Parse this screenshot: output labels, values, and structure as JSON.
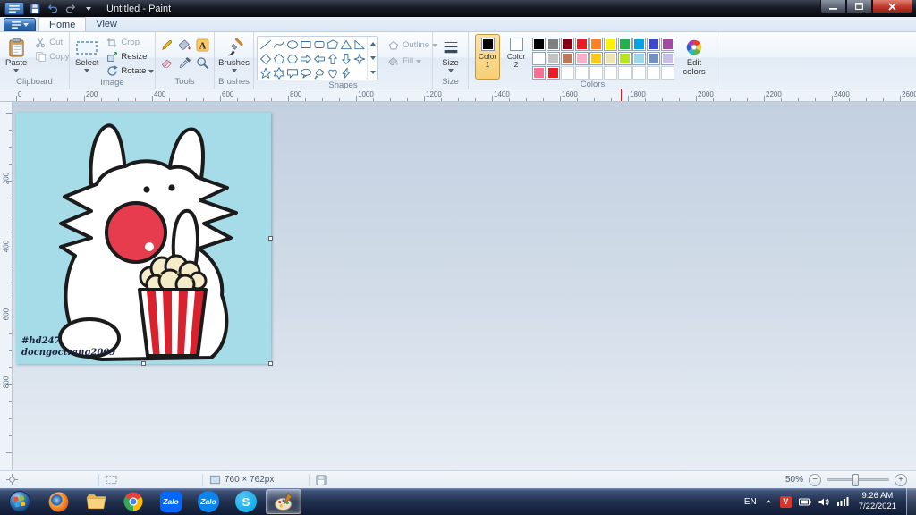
{
  "window": {
    "title": "Untitled - Paint"
  },
  "menu": {
    "home_tab": "Home",
    "view_tab": "View"
  },
  "ribbon": {
    "clipboard": {
      "label": "Clipboard",
      "paste": "Paste",
      "cut": "Cut",
      "copy": "Copy"
    },
    "image": {
      "label": "Image",
      "select": "Select",
      "crop": "Crop",
      "resize": "Resize",
      "rotate": "Rotate"
    },
    "tools": {
      "label": "Tools",
      "items": [
        "pencil",
        "fill",
        "text",
        "eraser",
        "picker",
        "magnifier"
      ]
    },
    "brushes": {
      "label": "Brushes"
    },
    "shapes": {
      "label": "Shapes",
      "outline": "Outline",
      "fill": "Fill",
      "items": [
        "line",
        "curve",
        "oval",
        "rectangle",
        "rounded-rectangle",
        "polygon",
        "triangle",
        "right-triangle",
        "diamond",
        "pentagon",
        "hexagon",
        "arrow-right",
        "arrow-left",
        "arrow-up",
        "arrow-down",
        "star-4",
        "star-5",
        "star-6",
        "callout-rect",
        "callout-oval",
        "callout-cloud",
        "heart",
        "lightning"
      ]
    },
    "size": {
      "label": "Size"
    },
    "colors": {
      "label": "Colors",
      "color1_label": "Color 1",
      "color2_label": "Color 2",
      "color1_value": "#000000",
      "color2_value": "#ffffff",
      "edit_label": "Edit colors",
      "palette": [
        [
          "#000000",
          "#7f7f7f",
          "#880015",
          "#ed1c24",
          "#ff7f27",
          "#fff200",
          "#22b14c",
          "#00a2e8",
          "#3f48cc",
          "#a349a4"
        ],
        [
          "#ffffff",
          "#c3c3c3",
          "#b97a57",
          "#ffaec9",
          "#ffc90e",
          "#efe4b0",
          "#b5e61d",
          "#99d9ea",
          "#7092be",
          "#c8bfe7"
        ],
        [
          "#ff6e8e",
          "#ed1c24",
          null,
          null,
          null,
          null,
          null,
          null,
          null,
          null
        ]
      ]
    }
  },
  "ruler": {
    "h_labels": [
      0,
      200,
      400,
      600,
      800,
      1000,
      1200,
      1400,
      1600,
      1800,
      2000,
      2200,
      2400,
      2600
    ],
    "v_labels": [
      200,
      400,
      600,
      800
    ],
    "marker_units": 1780
  },
  "canvas": {
    "bg_color": "#a6dbe8",
    "signature_line1": "#hd247",
    "signature_line2": "docngoctrang2009"
  },
  "status_bar": {
    "size_text": "760 × 762px",
    "zoom_label": "50%"
  },
  "taskbar": {
    "apps": [
      {
        "id": "start"
      },
      {
        "id": "firefox"
      },
      {
        "id": "explorer"
      },
      {
        "id": "chrome"
      },
      {
        "id": "zalo-square",
        "label": "Zalo"
      },
      {
        "id": "zalo-round",
        "label": "Zalo"
      },
      {
        "id": "skype",
        "label": "S"
      },
      {
        "id": "paint",
        "active": true
      }
    ],
    "tray": {
      "lang": "EN",
      "unikey_label": "V",
      "time": "9:26 AM",
      "date": "7/22/2021"
    }
  }
}
